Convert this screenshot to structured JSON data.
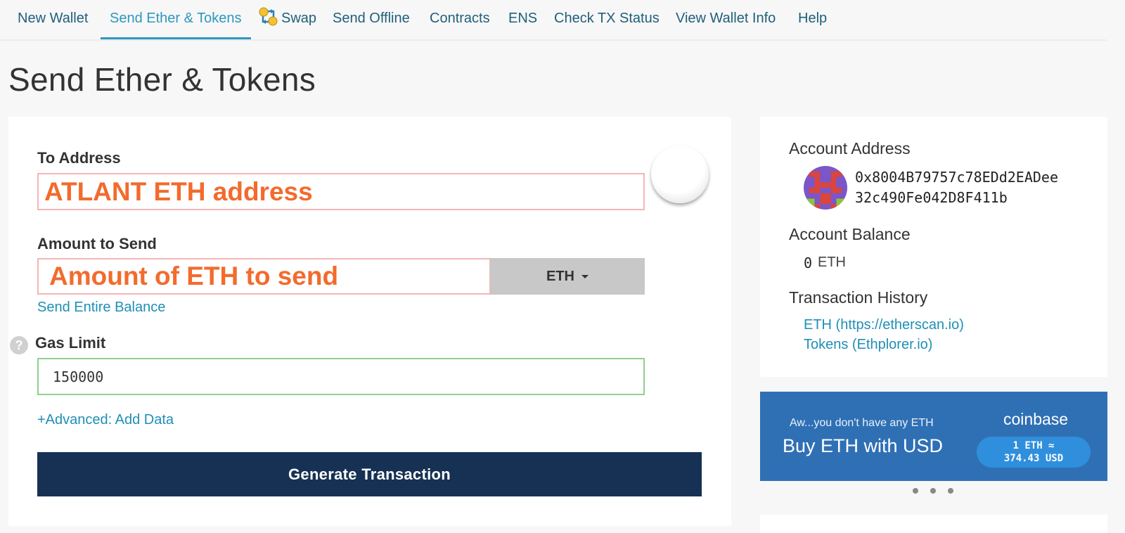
{
  "nav": {
    "items": [
      {
        "label": "New Wallet"
      },
      {
        "label": "Send Ether & Tokens",
        "active": true
      },
      {
        "label": "Swap"
      },
      {
        "label": "Send Offline"
      },
      {
        "label": "Contracts"
      },
      {
        "label": "ENS"
      },
      {
        "label": "Check TX Status"
      },
      {
        "label": "View Wallet Info"
      },
      {
        "label": "Help"
      }
    ]
  },
  "page": {
    "title": "Send Ether & Tokens"
  },
  "form": {
    "to_address": {
      "label": "To Address",
      "value": "ATLANT ETH address"
    },
    "amount": {
      "label": "Amount to Send",
      "value": "Amount of ETH to send",
      "token": "ETH"
    },
    "send_entire_balance": "Send Entire Balance",
    "gas_limit": {
      "label": "Gas Limit",
      "value": "150000",
      "help": "?"
    },
    "advanced_link": "+Advanced: Add Data",
    "generate_button": "Generate Transaction"
  },
  "account": {
    "address_heading": "Account Address",
    "address_line1": "0x8004B79757c78EDd2EADee",
    "address_line2": "32c490Fe042D8F411b",
    "balance_heading": "Account Balance",
    "balance_value": "0",
    "balance_unit": "ETH",
    "history_heading": "Transaction History",
    "history_eth": "ETH (https://etherscan.io)",
    "history_tokens": "Tokens (Ethplorer.io)"
  },
  "banner": {
    "subtitle": "Aw...you don't have any ETH",
    "title": "Buy ETH with USD",
    "brand": "coinbase",
    "rate_line1": "1 ETH ≈",
    "rate_line2": "374.43 USD"
  },
  "colors": {
    "nav_link": "#1f5f7a",
    "nav_active": "#2d98bd",
    "link": "#1f8fb5",
    "highlight_text": "#f26b2d",
    "button": "#163153",
    "banner": "#2f70b5"
  },
  "icons": {
    "swap": "swap-icon",
    "help": "help-icon",
    "identicon": "identicon",
    "dropdown": "chevron-down-icon"
  }
}
